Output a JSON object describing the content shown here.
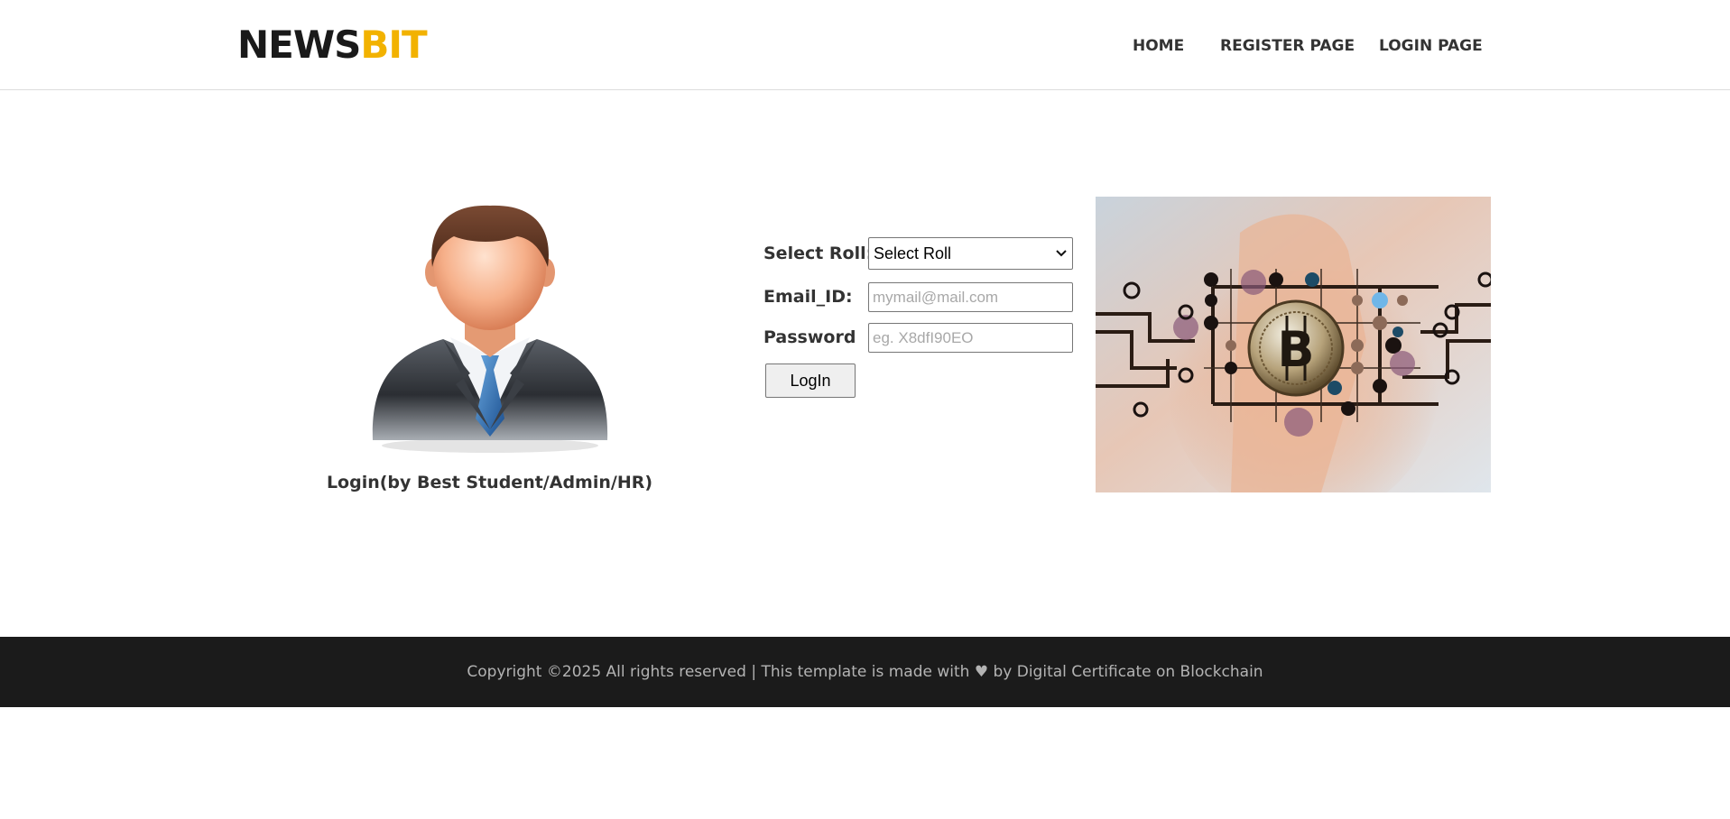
{
  "header": {
    "logo_part1": "NEWS",
    "logo_part2": "BIT",
    "nav": [
      "HOME",
      "REGISTER PAGE",
      "LOGIN PAGE"
    ]
  },
  "login": {
    "caption": "Login(by Best Student/Admin/HR)",
    "roll_label": "Select Roll:",
    "roll_selected": "Select Roll",
    "email_label": "Email_ID:",
    "email_placeholder": "mymail@mail.com",
    "password_label": "Password",
    "password_placeholder": "eg. X8dfI90EO",
    "button_label": "LogIn"
  },
  "footer": {
    "text_before": "Copyright ©2025 All rights reserved | This template is made with ",
    "heart": "♥",
    "text_after": " by Digital Certificate on Blockchain"
  },
  "colors": {
    "logo_dark": "#1a1a1a",
    "logo_accent": "#f2b200",
    "footer_bg": "#1b1b1b",
    "footer_text": "#b3b3b3"
  },
  "icons": {
    "avatar": "businessman-avatar-icon",
    "dropdown": "chevron-down-icon",
    "heart": "heart-icon"
  }
}
